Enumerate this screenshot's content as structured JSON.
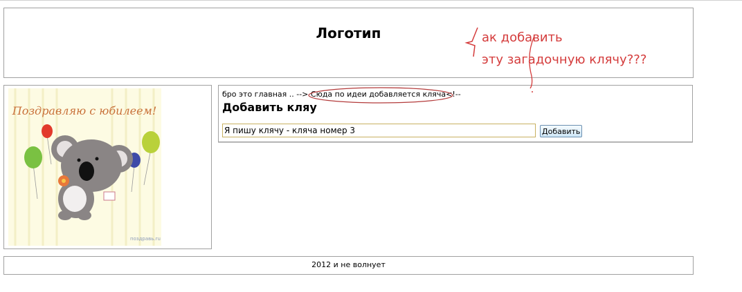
{
  "header": {
    "logo_text": "Логотип"
  },
  "content": {
    "breadcrumb": "бро это главная .. --> Сюда по идеи добавляется кляча<!--",
    "heading": "Добавить кляу",
    "input_value": "Я пишу клячу - кляча номер 3",
    "add_button_label": "Добавить"
  },
  "footer": {
    "text": "2012 и не волнует"
  },
  "card": {
    "greeting_text": "Поздравляю с юбилеем!",
    "site_text": "поздравь.ru"
  },
  "annotations": {
    "line1": "ак добавить",
    "line2": "эту загадочную клячу???",
    "color": "#d43b3b"
  }
}
